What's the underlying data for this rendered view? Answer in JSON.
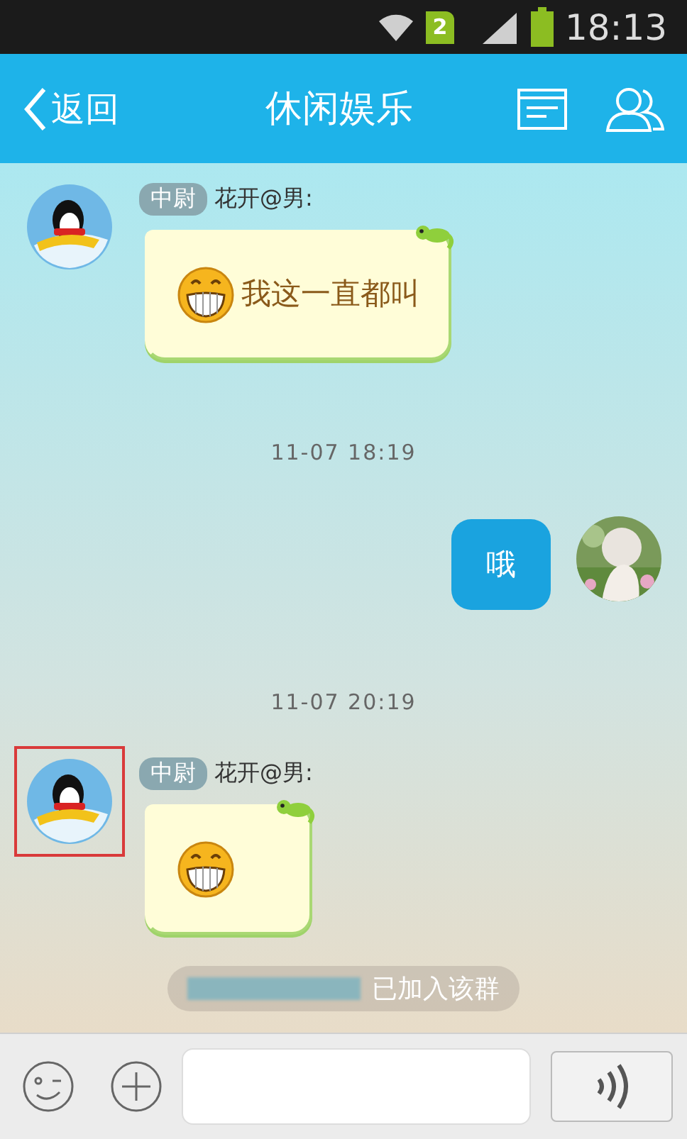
{
  "status_bar": {
    "sim_badge": "2",
    "time": "18:13"
  },
  "header": {
    "back": "返回",
    "title": "休闲娱乐"
  },
  "messages": [
    {
      "kind": "received",
      "rank": "中尉",
      "sender": "花开@男:",
      "emoji": true,
      "text": "我这一直都叫",
      "highlighted": false
    },
    {
      "kind": "time",
      "text": "11-07 18:19"
    },
    {
      "kind": "sent",
      "text": "哦"
    },
    {
      "kind": "time",
      "text": "11-07 20:19"
    },
    {
      "kind": "received",
      "rank": "中尉",
      "sender": "花开@男:",
      "emoji": true,
      "highlighted": true
    },
    {
      "kind": "notice",
      "text": "已加入该群"
    }
  ]
}
